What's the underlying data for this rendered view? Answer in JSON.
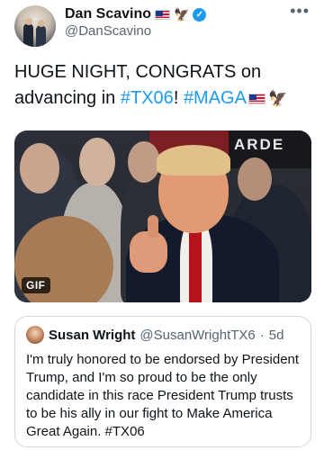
{
  "author": {
    "display_name": "Dan Scavino",
    "handle": "@DanScavino",
    "verified": true,
    "badges": [
      "us-flag-emoji",
      "eagle-emoji"
    ]
  },
  "menu": {
    "more_label": "•••"
  },
  "tweet": {
    "text_before": "HUGE NIGHT, CONGRATS on advancing in ",
    "hashtag_1": "#TX06",
    "text_middle": "! ",
    "hashtag_2": "#MAGA",
    "trailing_emoji": [
      "us-flag-emoji",
      "eagle-emoji"
    ]
  },
  "media": {
    "type": "gif",
    "badge_label": "GIF",
    "background_sign_text": "ARDE"
  },
  "quoted_tweet": {
    "display_name": "Susan Wright",
    "handle": "@SusanWrightTX6",
    "separator": "·",
    "time": "5d",
    "text": "I'm truly honored to be endorsed by President Trump, and I'm so proud to be the only candidate in this race President Trump trusts to be his ally in our fight to Make America Great Again. #TX06"
  },
  "colors": {
    "link": "#1d9bf0",
    "verified": "#1d9bf0",
    "secondary_text": "#536471",
    "border": "#cfd9de"
  }
}
